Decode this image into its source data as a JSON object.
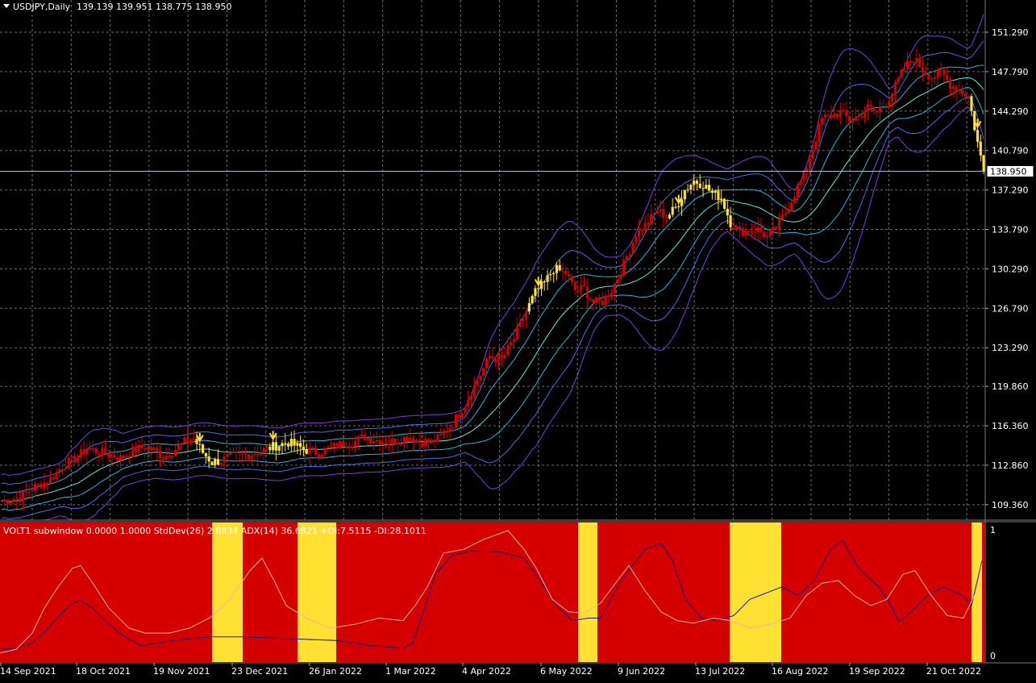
{
  "header": {
    "symbol": "USDJPY,Daily",
    "ohlc": "139.139 139.951 138.775 138.950"
  },
  "subwindow": {
    "title": "VOLT1 subwindow 0.0000 1.0000  StdDev(26) 2.8834  ADX(14) 36.6821 +DI:7.5115 -DI:28.1011",
    "scale_top": "1",
    "scale_bottom": "0"
  },
  "colors": {
    "background": "#000000",
    "grid": "#6e6e6e",
    "bull_candle": "#d40000",
    "highlight": "#ffe033",
    "band_outer": "#7b3fd6",
    "band_mid": "#4a6fe0",
    "band_inner": "#31b3d6",
    "ma_center": "#6fe6d8",
    "price_line": "#b0c8d8",
    "sub_bg": "#d40000",
    "adx_line": "#12187a",
    "std_line": "#e8b8a0"
  },
  "chart_data": [
    {
      "type": "candlestick",
      "title": "USDJPY,Daily",
      "y_ticks": [
        "151.290",
        "147.790",
        "144.290",
        "140.790",
        "137.290",
        "133.790",
        "130.290",
        "126.790",
        "123.290",
        "119.860",
        "116.360",
        "112.860",
        "109.360"
      ],
      "y_tick_values": [
        151.29,
        147.79,
        144.29,
        140.79,
        137.29,
        133.79,
        130.29,
        126.79,
        123.29,
        119.86,
        116.36,
        112.86,
        109.36
      ],
      "ylim": [
        108.0,
        153.0
      ],
      "current_price": 138.95,
      "current_price_label": "138.950",
      "x_ticks": [
        "14 Sep 2021",
        "18 Oct 2021",
        "19 Nov 2021",
        "23 Dec 2021",
        "26 Jan 2022",
        "1 Mar 2022",
        "4 Apr 2022",
        "6 May 2022",
        "9 Jun 2022",
        "13 Jul 2022",
        "16 Aug 2022",
        "19 Sep 2022",
        "21 Oct 2022"
      ],
      "close_path": [
        [
          0,
          109.7
        ],
        [
          6,
          110.0
        ],
        [
          10,
          110.8
        ],
        [
          16,
          111.6
        ],
        [
          20,
          112.8
        ],
        [
          25,
          113.6
        ],
        [
          28,
          114.4
        ],
        [
          32,
          114.0
        ],
        [
          36,
          113.8
        ],
        [
          39,
          113.5
        ],
        [
          43,
          114.1
        ],
        [
          47,
          114.5
        ],
        [
          50,
          114.2
        ],
        [
          53,
          113.6
        ],
        [
          56,
          114.1
        ],
        [
          60,
          114.9
        ],
        [
          63,
          115.2
        ],
        [
          66,
          114.0
        ],
        [
          69,
          113.1
        ],
        [
          72,
          113.3
        ],
        [
          75,
          113.6
        ],
        [
          78,
          113.7
        ],
        [
          82,
          113.9
        ],
        [
          86,
          114.2
        ],
        [
          90,
          114.6
        ],
        [
          94,
          114.9
        ],
        [
          97,
          114.5
        ],
        [
          100,
          114.2
        ],
        [
          104,
          114.0
        ],
        [
          108,
          114.4
        ],
        [
          112,
          114.8
        ],
        [
          116,
          115.0
        ],
        [
          119,
          115.4
        ],
        [
          123,
          115.1
        ],
        [
          127,
          114.9
        ],
        [
          131,
          115.2
        ],
        [
          134,
          115.4
        ],
        [
          137,
          115.0
        ],
        [
          141,
          114.9
        ],
        [
          144,
          115.4
        ],
        [
          148,
          116.6
        ],
        [
          152,
          118.3
        ],
        [
          156,
          120.4
        ],
        [
          160,
          122.5
        ],
        [
          164,
          122.2
        ],
        [
          168,
          124.1
        ],
        [
          172,
          126.5
        ],
        [
          175,
          128.2
        ],
        [
          178,
          129.0
        ],
        [
          181,
          130.3
        ],
        [
          185,
          129.9
        ],
        [
          188,
          128.4
        ],
        [
          191,
          128.5
        ],
        [
          194,
          127.3
        ],
        [
          197,
          127.4
        ],
        [
          200,
          128.4
        ],
        [
          204,
          130.7
        ],
        [
          208,
          133.4
        ],
        [
          212,
          134.4
        ],
        [
          215,
          135.5
        ],
        [
          218,
          134.9
        ],
        [
          221,
          135.7
        ],
        [
          224,
          137.3
        ],
        [
          227,
          138.1
        ],
        [
          230,
          137.8
        ],
        [
          233,
          137.0
        ],
        [
          236,
          136.6
        ],
        [
          239,
          134.4
        ],
        [
          242,
          133.6
        ],
        [
          245,
          133.7
        ],
        [
          248,
          133.8
        ],
        [
          251,
          133.1
        ],
        [
          254,
          133.9
        ],
        [
          257,
          135.3
        ],
        [
          260,
          137.0
        ],
        [
          263,
          138.6
        ],
        [
          266,
          141.0
        ],
        [
          269,
          143.6
        ],
        [
          272,
          143.9
        ],
        [
          275,
          144.2
        ],
        [
          278,
          143.5
        ],
        [
          281,
          143.8
        ],
        [
          284,
          144.6
        ],
        [
          287,
          144.2
        ],
        [
          290,
          145.0
        ],
        [
          293,
          146.5
        ],
        [
          296,
          148.1
        ],
        [
          299,
          149.0
        ],
        [
          302,
          148.0
        ],
        [
          305,
          147.3
        ],
        [
          308,
          147.7
        ],
        [
          311,
          146.7
        ],
        [
          314,
          146.2
        ],
        [
          317,
          145.6
        ],
        [
          320,
          141.5
        ],
        [
          322,
          138.95
        ]
      ],
      "yellow_segments": [
        [
          64,
          71
        ],
        [
          88,
          100
        ],
        [
          173,
          183
        ],
        [
          219,
          239
        ],
        [
          318,
          322
        ]
      ],
      "arrows": [
        65,
        89,
        176,
        222,
        320
      ]
    },
    {
      "type": "line",
      "title": "VOLT1 subwindow 0.0000 1.0000",
      "ylim": [
        0,
        1
      ],
      "yellow_bars_x": [
        [
          263,
          301
        ],
        [
          369,
          417
        ],
        [
          717,
          741
        ],
        [
          905,
          969
        ],
        [
          1205,
          1218
        ]
      ],
      "series": [
        {
          "name": "ADX(14)",
          "values": [
            [
              0,
              0.05
            ],
            [
              20,
              0.06
            ],
            [
              40,
              0.1
            ],
            [
              60,
              0.22
            ],
            [
              75,
              0.33
            ],
            [
              90,
              0.42
            ],
            [
              100,
              0.44
            ],
            [
              115,
              0.38
            ],
            [
              135,
              0.25
            ],
            [
              155,
              0.15
            ],
            [
              175,
              0.08
            ],
            [
              195,
              0.1
            ],
            [
              225,
              0.13
            ],
            [
              260,
              0.15
            ],
            [
              300,
              0.15
            ],
            [
              340,
              0.14
            ],
            [
              380,
              0.13
            ],
            [
              420,
              0.12
            ],
            [
              460,
              0.08
            ],
            [
              500,
              0.06
            ],
            [
              512,
              0.1
            ],
            [
              525,
              0.35
            ],
            [
              540,
              0.65
            ],
            [
              560,
              0.8
            ],
            [
              585,
              0.84
            ],
            [
              620,
              0.83
            ],
            [
              650,
              0.78
            ],
            [
              670,
              0.6
            ],
            [
              690,
              0.4
            ],
            [
              710,
              0.28
            ],
            [
              730,
              0.3
            ],
            [
              745,
              0.3
            ],
            [
              770,
              0.6
            ],
            [
              800,
              0.85
            ],
            [
              820,
              0.9
            ],
            [
              835,
              0.75
            ],
            [
              850,
              0.45
            ],
            [
              870,
              0.3
            ],
            [
              890,
              0.28
            ],
            [
              910,
              0.32
            ],
            [
              930,
              0.45
            ],
            [
              950,
              0.5
            ],
            [
              970,
              0.55
            ],
            [
              990,
              0.48
            ],
            [
              1010,
              0.6
            ],
            [
              1030,
              0.85
            ],
            [
              1045,
              0.92
            ],
            [
              1065,
              0.7
            ],
            [
              1090,
              0.55
            ],
            [
              1105,
              0.4
            ],
            [
              1115,
              0.27
            ],
            [
              1130,
              0.35
            ],
            [
              1150,
              0.48
            ],
            [
              1170,
              0.55
            ],
            [
              1195,
              0.48
            ],
            [
              1205,
              0.4
            ],
            [
              1218,
              0.76
            ]
          ]
        },
        {
          "name": "StdDev(26)",
          "values": [
            [
              0,
              0.02
            ],
            [
              20,
              0.05
            ],
            [
              40,
              0.18
            ],
            [
              55,
              0.38
            ],
            [
              72,
              0.55
            ],
            [
              90,
              0.7
            ],
            [
              100,
              0.72
            ],
            [
              115,
              0.58
            ],
            [
              135,
              0.38
            ],
            [
              160,
              0.22
            ],
            [
              180,
              0.18
            ],
            [
              210,
              0.18
            ],
            [
              235,
              0.22
            ],
            [
              260,
              0.3
            ],
            [
              285,
              0.45
            ],
            [
              310,
              0.68
            ],
            [
              325,
              0.78
            ],
            [
              340,
              0.6
            ],
            [
              355,
              0.4
            ],
            [
              380,
              0.3
            ],
            [
              410,
              0.22
            ],
            [
              440,
              0.25
            ],
            [
              470,
              0.3
            ],
            [
              500,
              0.28
            ],
            [
              515,
              0.4
            ],
            [
              530,
              0.55
            ],
            [
              550,
              0.82
            ],
            [
              575,
              0.85
            ],
            [
              600,
              0.93
            ],
            [
              630,
              1.0
            ],
            [
              650,
              0.85
            ],
            [
              665,
              0.7
            ],
            [
              685,
              0.45
            ],
            [
              705,
              0.35
            ],
            [
              725,
              0.34
            ],
            [
              745,
              0.42
            ],
            [
              760,
              0.55
            ],
            [
              780,
              0.72
            ],
            [
              800,
              0.52
            ],
            [
              820,
              0.35
            ],
            [
              840,
              0.28
            ],
            [
              860,
              0.26
            ],
            [
              885,
              0.3
            ],
            [
              905,
              0.28
            ],
            [
              930,
              0.22
            ],
            [
              955,
              0.25
            ],
            [
              980,
              0.3
            ],
            [
              1000,
              0.48
            ],
            [
              1020,
              0.58
            ],
            [
              1040,
              0.6
            ],
            [
              1060,
              0.48
            ],
            [
              1080,
              0.4
            ],
            [
              1100,
              0.45
            ],
            [
              1120,
              0.65
            ],
            [
              1135,
              0.68
            ],
            [
              1155,
              0.48
            ],
            [
              1175,
              0.32
            ],
            [
              1195,
              0.3
            ],
            [
              1210,
              0.5
            ],
            [
              1218,
              0.74
            ]
          ]
        }
      ]
    }
  ]
}
